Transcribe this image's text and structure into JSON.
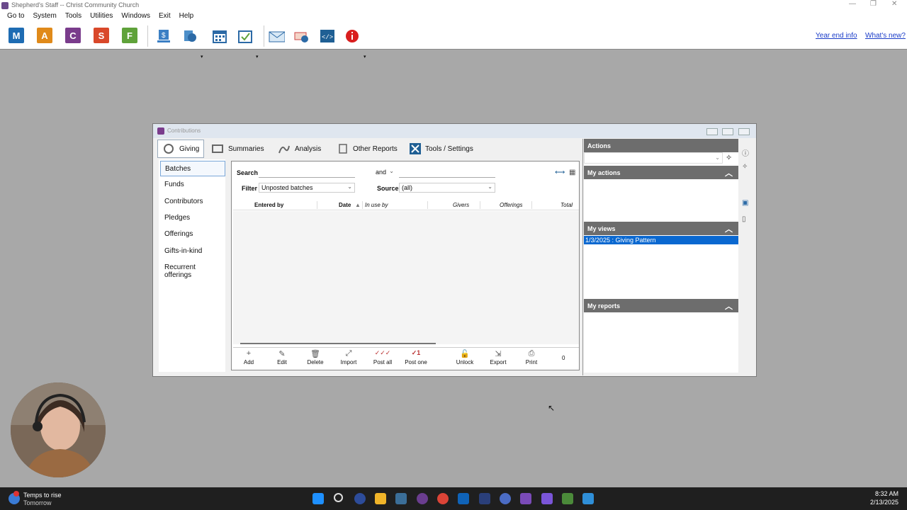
{
  "app": {
    "title": "Shepherd's Staff -- Christ Community Church"
  },
  "menu": [
    "Go to",
    "System",
    "Tools",
    "Utilities",
    "Windows",
    "Exit",
    "Help"
  ],
  "toolbar": {
    "apps": [
      {
        "label": "M",
        "color": "#1e6cb3"
      },
      {
        "label": "A",
        "color": "#e08a1a"
      },
      {
        "label": "C",
        "color": "#7a3c8c"
      },
      {
        "label": "S",
        "color": "#d9482a"
      },
      {
        "label": "F",
        "color": "#5fa23a"
      }
    ],
    "icons": [
      "statement-icon",
      "globe-document-icon",
      "calendar-icon",
      "calendar-check-icon",
      "mail-icon",
      "email-send-icon",
      "code-icon",
      "info-icon"
    ],
    "year_end": "Year end info",
    "whats_new": "What's new?"
  },
  "window": {
    "title": "Contributions"
  },
  "tabs": [
    {
      "label": "Giving",
      "icon": "giving-icon"
    },
    {
      "label": "Summaries",
      "icon": "summaries-icon"
    },
    {
      "label": "Analysis",
      "icon": "analysis-icon"
    },
    {
      "label": "Other Reports",
      "icon": "reports-icon"
    },
    {
      "label": "Tools / Settings",
      "icon": "tools-icon"
    }
  ],
  "sidebar": [
    "Batches",
    "Funds",
    "Contributors",
    "Pledges",
    "Offerings",
    "Gifts-in-kind",
    "Recurrent offerings"
  ],
  "search": {
    "label": "Search",
    "value": "",
    "and_label": "and",
    "value2": ""
  },
  "filter": {
    "label": "Filter",
    "value": "Unposted batches",
    "source_label": "Source",
    "source_value": "(all)"
  },
  "columns": [
    "Entered by",
    "Date",
    "In use by",
    "Givers",
    "Offerings",
    "Total"
  ],
  "actions": [
    {
      "label": "Add",
      "icon": "plus-icon",
      "glyph": "+"
    },
    {
      "label": "Edit",
      "icon": "pencil-icon",
      "glyph": "✎"
    },
    {
      "label": "Delete",
      "icon": "trash-icon",
      "glyph": "🗑"
    },
    {
      "label": "Import",
      "icon": "import-icon",
      "glyph": "⤢"
    },
    {
      "label": "Post all",
      "icon": "post-all-icon",
      "glyph": "✓✓✓"
    },
    {
      "label": "Post one",
      "icon": "post-one-icon",
      "glyph": "✓1"
    },
    {
      "label": "Unlock",
      "icon": "unlock-icon",
      "glyph": "🔓"
    },
    {
      "label": "Export",
      "icon": "export-icon",
      "glyph": "⇲"
    },
    {
      "label": "Print",
      "icon": "print-icon",
      "glyph": "⎙"
    }
  ],
  "count": "0",
  "right": {
    "actions_title": "Actions",
    "my_actions": "My actions",
    "my_views": "My views",
    "view_item": "1/3/2025 : Giving Pattern",
    "my_reports": "My reports"
  },
  "taskbar": {
    "weather_title": "Temps to rise",
    "weather_sub": "Tomorrow",
    "time": "8:32 AM",
    "date": "2/13/2025"
  }
}
